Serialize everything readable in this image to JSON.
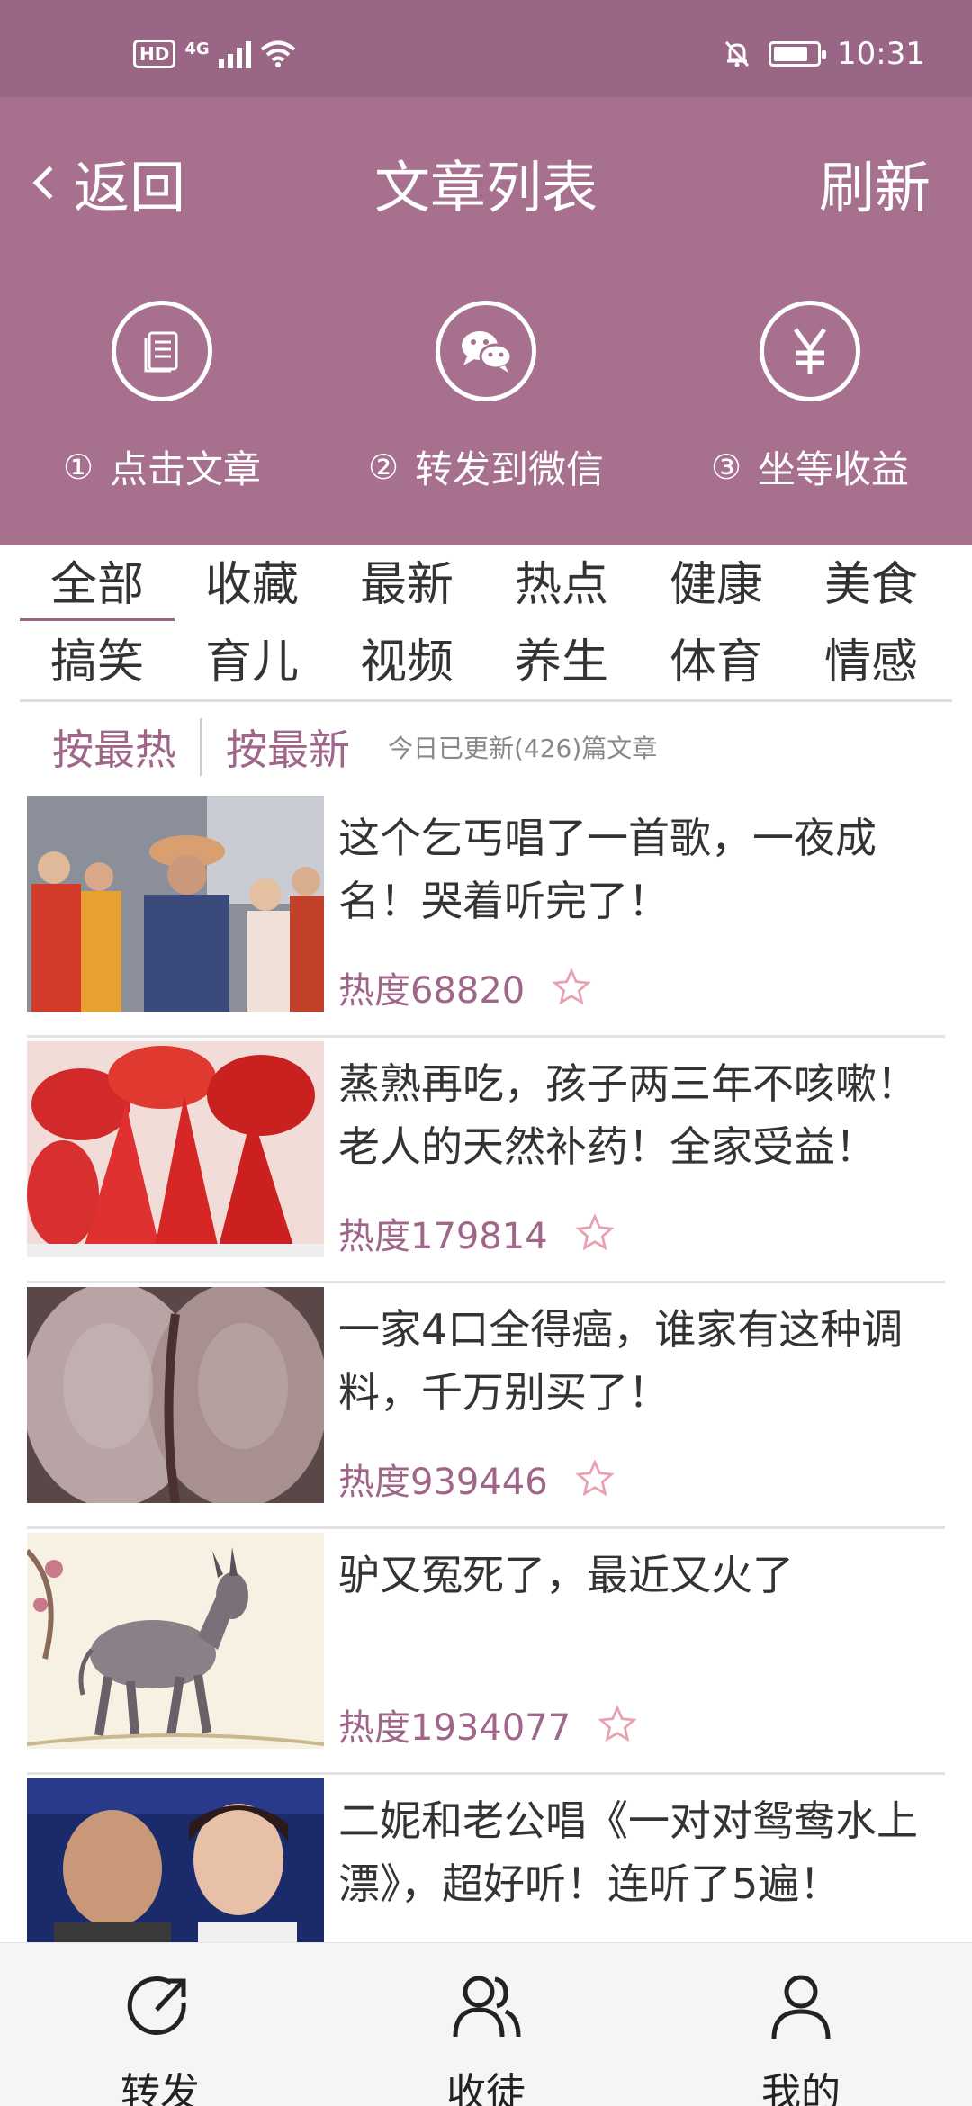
{
  "status": {
    "hd": "HD",
    "network": "4G",
    "time": "10:31",
    "battery_level": 0.8
  },
  "nav": {
    "back_label": "返回",
    "title": "文章列表",
    "refresh_label": "刷新"
  },
  "steps": [
    {
      "num": "①",
      "label": "点击文章",
      "icon": "document-icon"
    },
    {
      "num": "②",
      "label": "转发到微信",
      "icon": "wechat-icon"
    },
    {
      "num": "③",
      "label": "坐等收益",
      "icon": "yuan-icon"
    }
  ],
  "categories": [
    "全部",
    "收藏",
    "最新",
    "热点",
    "健康",
    "美食",
    "搞笑",
    "育儿",
    "视频",
    "养生",
    "体育",
    "情感"
  ],
  "active_category": "全部",
  "sort": {
    "hot": "按最热",
    "new": "按最新",
    "updated": "今日已更新(426)篇文章"
  },
  "articles": [
    {
      "title": "这个乞丐唱了一首歌，一夜成名！哭着听完了！",
      "heat": "热度68820"
    },
    {
      "title": "蒸熟再吃，孩子两三年不咳嗽！老人的天然补药！全家受益！",
      "heat": "热度179814"
    },
    {
      "title": "一家4口全得癌，谁家有这种调料，千万别买了！",
      "heat": "热度939446"
    },
    {
      "title": "驴又冤死了，最近又火了",
      "heat": "热度1934077"
    },
    {
      "title": "二妮和老公唱《一对对鸳鸯水上漂》，超好听！连听了5遍！",
      "heat": ""
    }
  ],
  "tabbar": [
    {
      "label": "转发",
      "icon": "share-icon"
    },
    {
      "label": "收徒",
      "icon": "users-icon"
    },
    {
      "label": "我的",
      "icon": "user-icon"
    }
  ],
  "colors": {
    "theme": "#a7708f",
    "status_bar": "#9a6685",
    "accent_text": "#a0668a",
    "star": "#e9a0b0"
  }
}
